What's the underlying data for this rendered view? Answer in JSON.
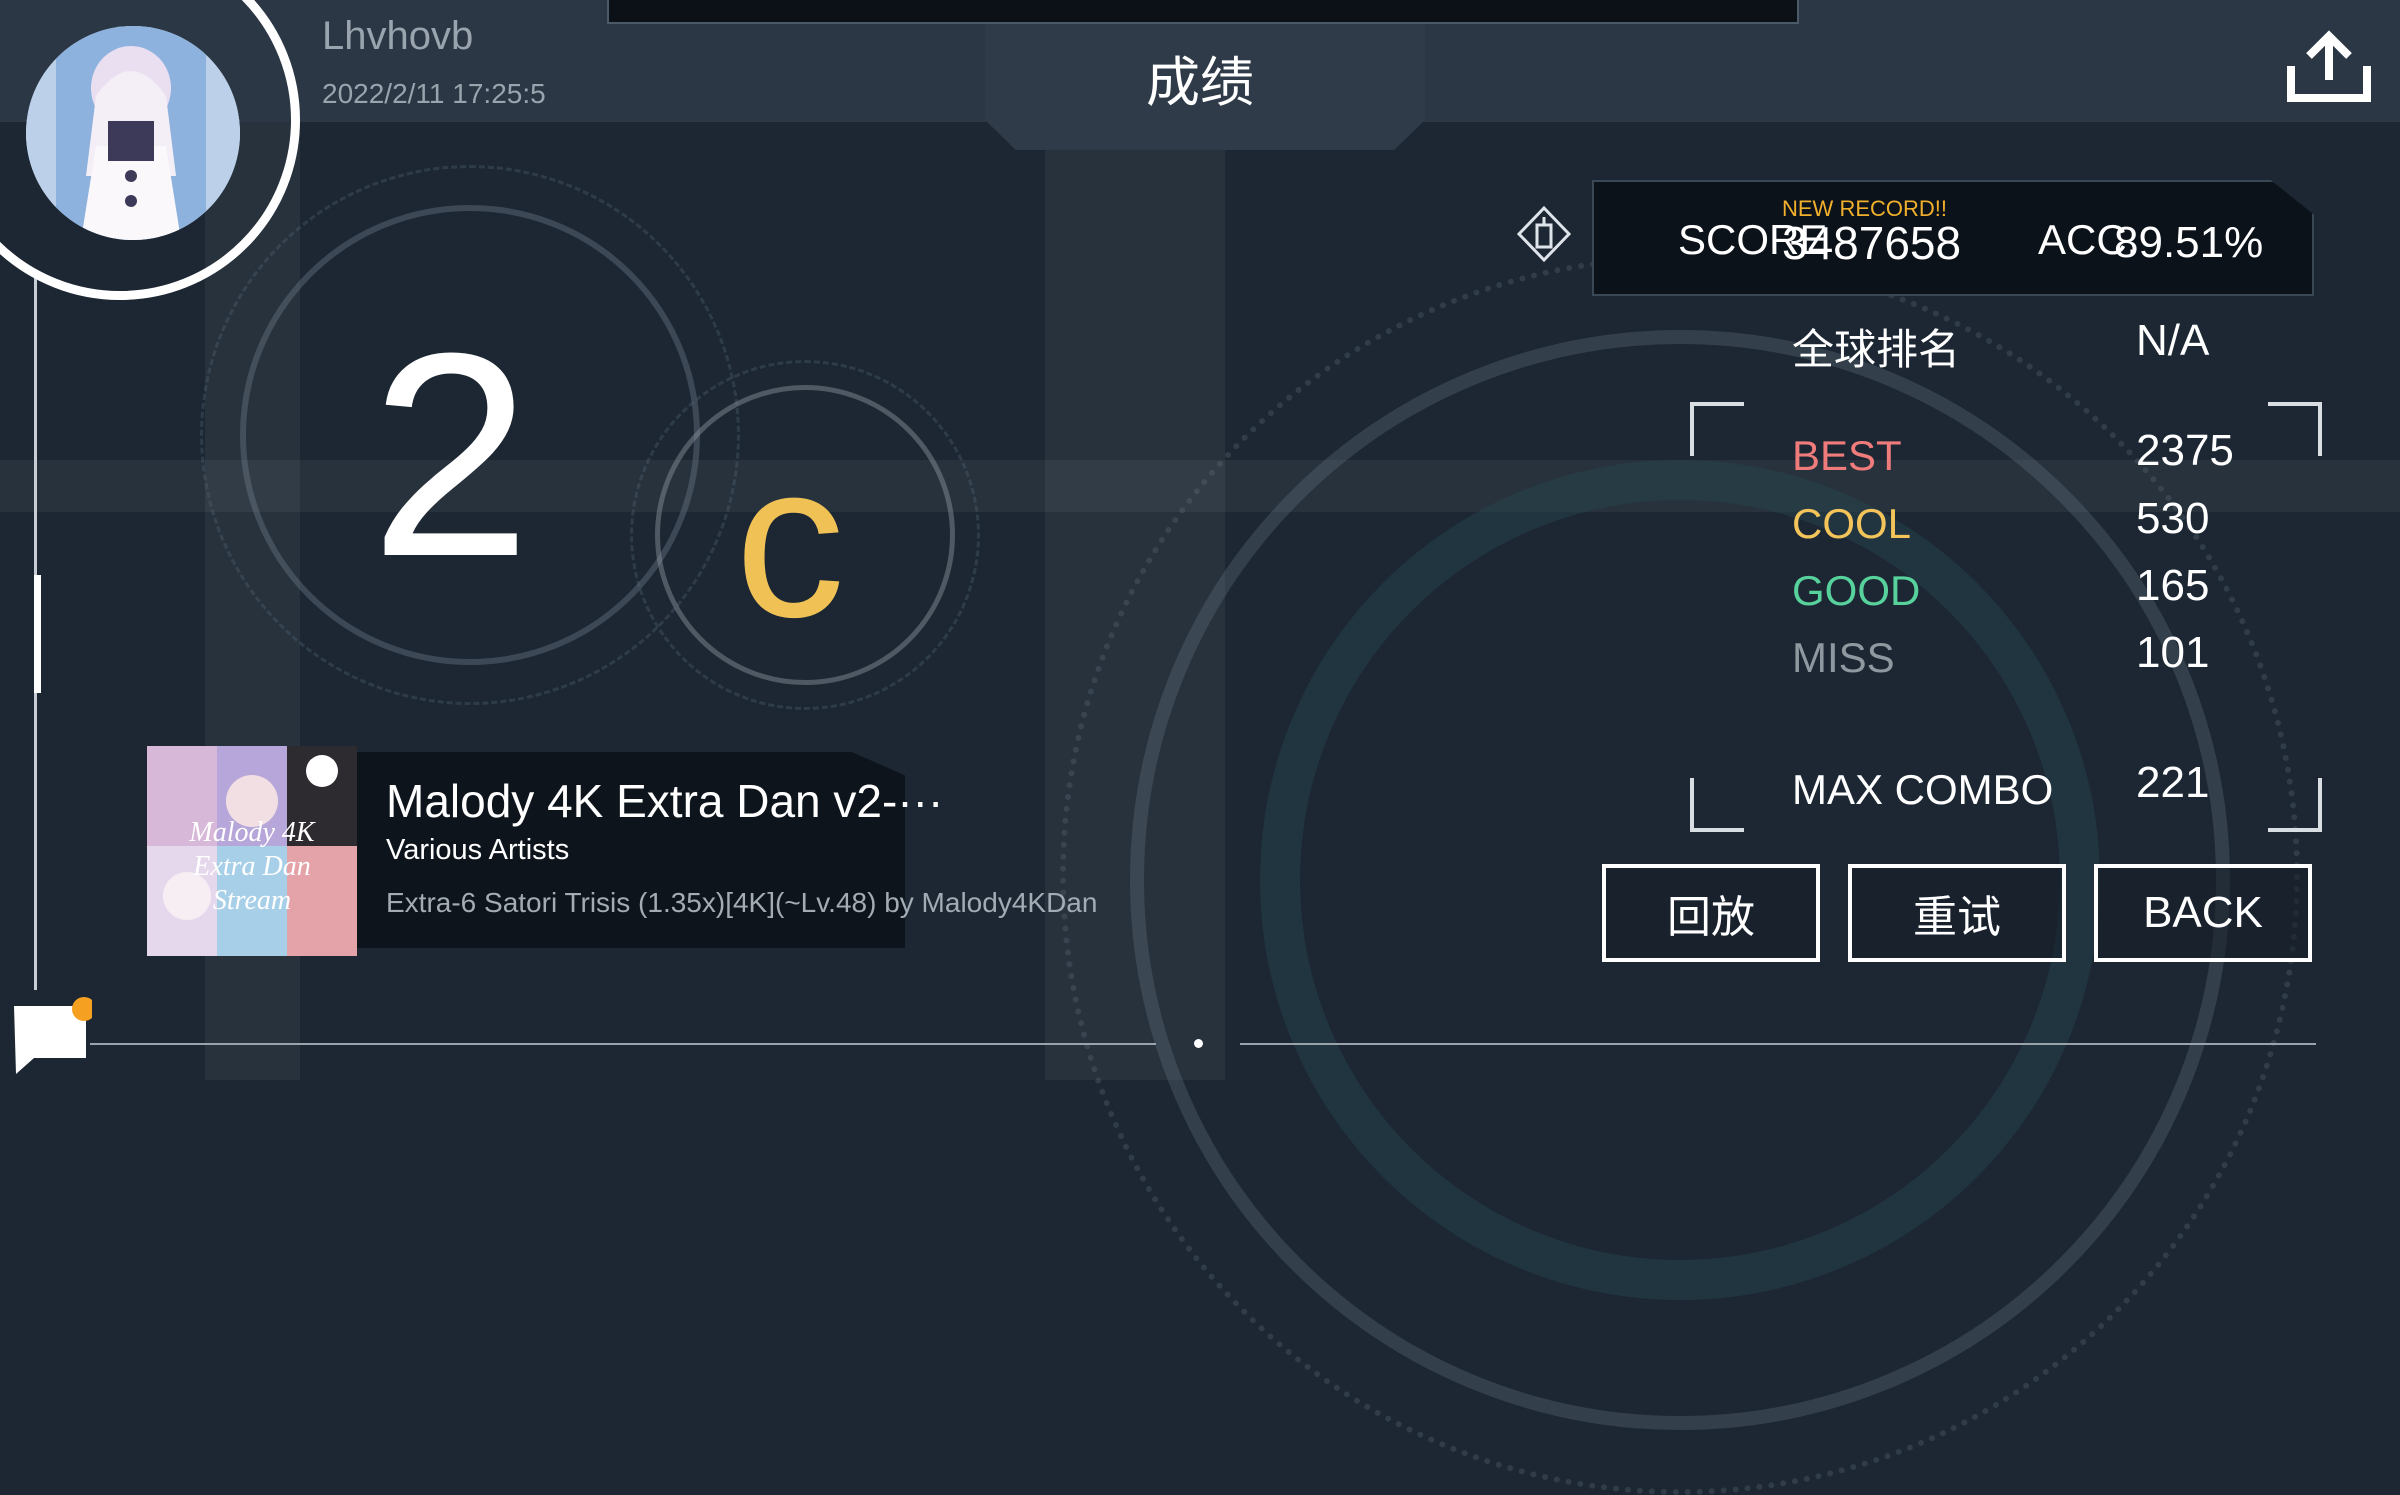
{
  "header": {
    "title": "成绩",
    "player_name": "Lhvhovb",
    "date": "2022/2/11 17:25:5"
  },
  "rank": {
    "number": "2",
    "grade": "c"
  },
  "score": {
    "new_record": "NEW RECORD!!",
    "score_label": "SCORE",
    "score_value": "3487658",
    "acc_label": "ACC.",
    "acc_value": "89.51%"
  },
  "stats": {
    "global_rank_label": "全球排名",
    "global_rank_value": "N/A",
    "best_label": "BEST",
    "best_value": "2375",
    "cool_label": "COOL",
    "cool_value": "530",
    "good_label": "GOOD",
    "good_value": "165",
    "miss_label": "MISS",
    "miss_value": "101",
    "max_combo_label": "MAX COMBO",
    "max_combo_value": "221"
  },
  "colors": {
    "best": "#f07b7b",
    "cool": "#f2c45a",
    "good": "#58d29c",
    "miss": "#8f979f",
    "grade": "#f0c255",
    "new_record": "#f0b02c"
  },
  "buttons": {
    "replay": "回放",
    "retry": "重试",
    "back": "BACK"
  },
  "song": {
    "cover_text": "Malody 4K Extra Dan Stream",
    "title": "Malody 4K Extra Dan v2-···",
    "artist": "Various Artists",
    "difficulty": "Extra-6 Satori Trisis (1.35x)[4K](~Lv.48) by Malody4KDan"
  },
  "icons": {
    "share": "share-upload-icon",
    "chat": "chat-bubble-icon",
    "mode": "key-mode-icon"
  }
}
